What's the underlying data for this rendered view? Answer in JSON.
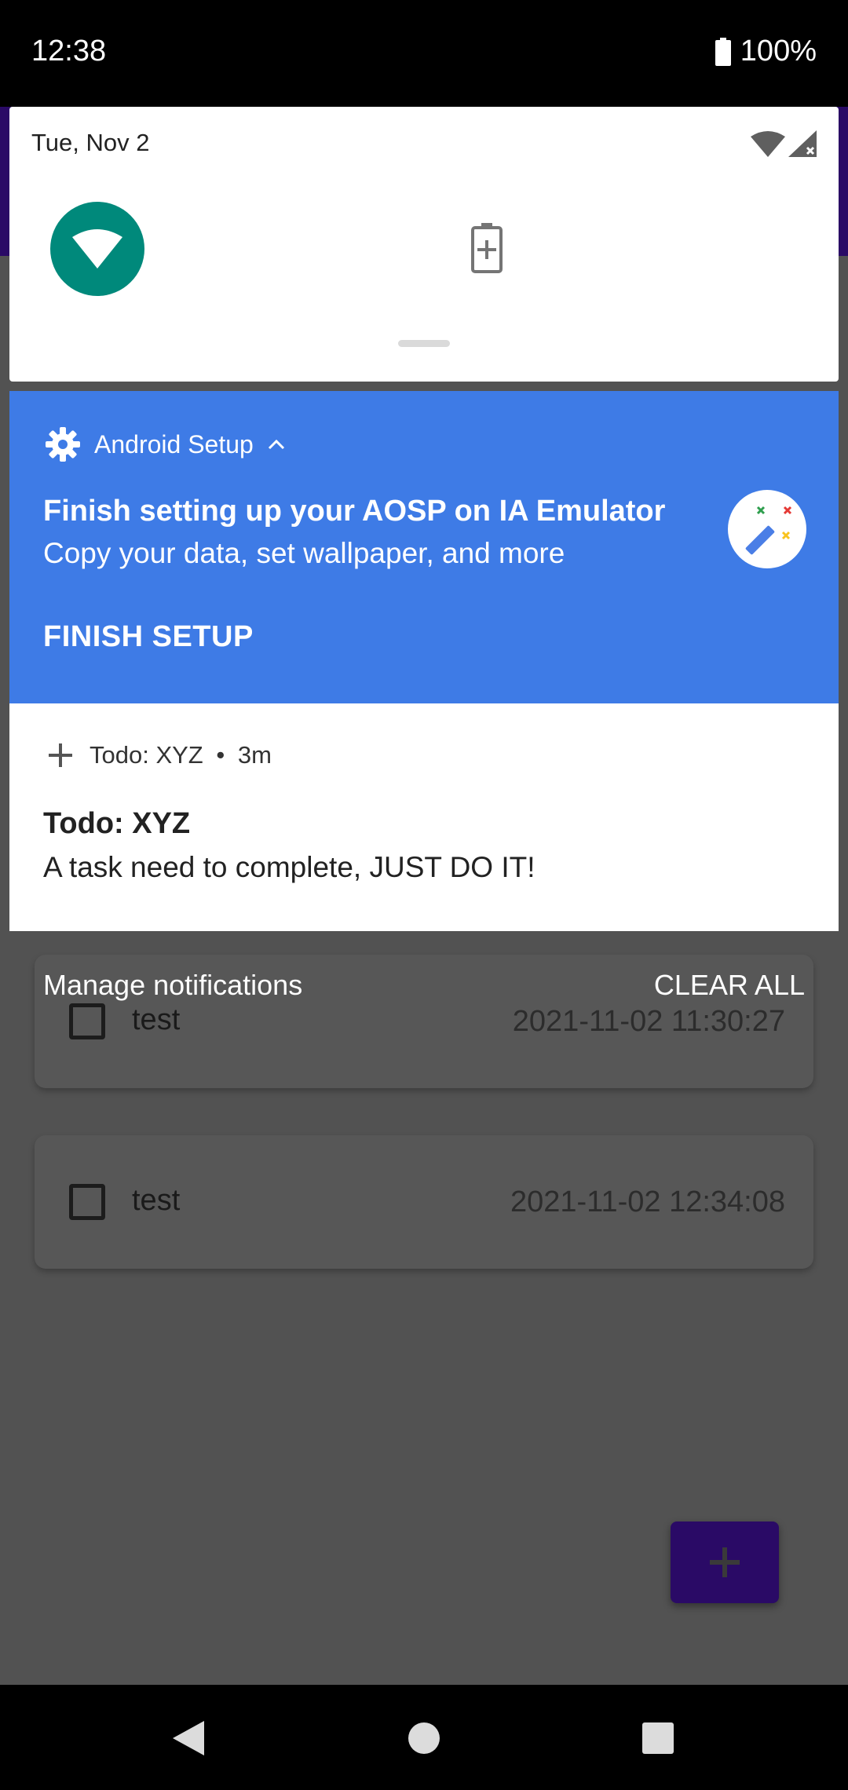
{
  "status_bar": {
    "time": "12:38",
    "battery": "100%"
  },
  "quick_settings": {
    "date": "Tue, Nov 2"
  },
  "setup_notification": {
    "app_name": "Android Setup",
    "title": "Finish setting up your AOSP on IA Emulator",
    "text": "Copy your data, set wallpaper, and more",
    "action": "FINISH SETUP"
  },
  "todo_notification": {
    "app_name": "Todo: XYZ",
    "separator": "•",
    "time": "3m",
    "title": "Todo: XYZ",
    "text": "A task need to complete, JUST DO IT!"
  },
  "notification_footer": {
    "manage": "Manage notifications",
    "clear_all": "CLEAR ALL"
  },
  "todo_list": {
    "items": [
      {
        "title": "test",
        "date": "2021-11-02 11:30:27"
      },
      {
        "title": "test",
        "date": "2021-11-02 12:34:08"
      }
    ]
  },
  "colors": {
    "setup_bg": "#3e7be6",
    "wifi_tile": "#00897b",
    "app_primary": "#2a0a66"
  },
  "icons": [
    "battery-icon",
    "wifi-signal-icon",
    "cell-signal-icon",
    "wifi-icon",
    "battery-saver-icon",
    "gear-icon",
    "chevron-up-icon",
    "magic-wand-icon",
    "add-icon",
    "back-icon",
    "home-icon",
    "recents-icon"
  ]
}
